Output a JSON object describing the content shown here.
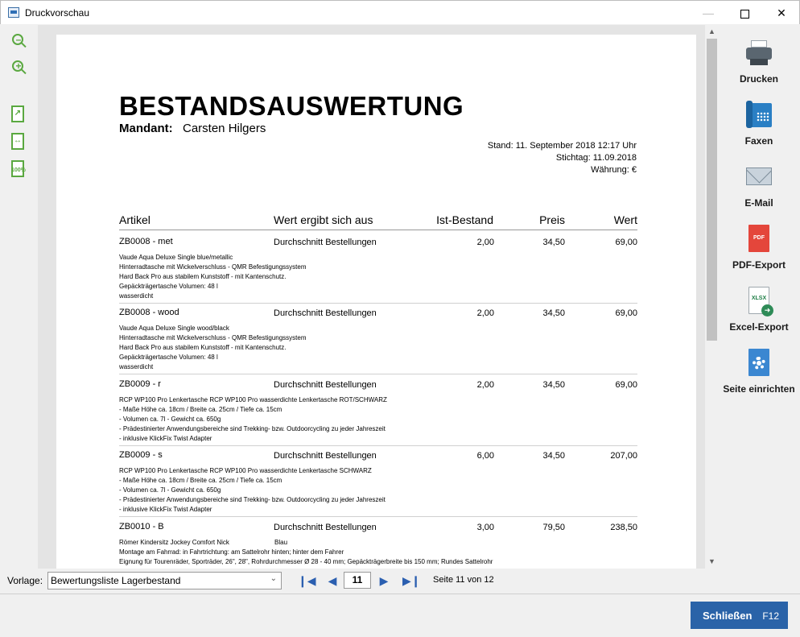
{
  "window": {
    "title": "Druckvorschau"
  },
  "toolbar_left": [
    {
      "name": "zoom-out",
      "icon": "zoom-out-icon"
    },
    {
      "name": "zoom-in",
      "icon": "zoom-in-icon"
    },
    {
      "name": "fit-page",
      "icon": "fit-page-icon"
    },
    {
      "name": "fit-width",
      "icon": "fit-width-icon"
    },
    {
      "name": "zoom-100",
      "icon": "zoom-100-icon",
      "text": "100%"
    }
  ],
  "report": {
    "title": "BESTANDSAUSWERTUNG",
    "mandant_label": "Mandant:",
    "mandant_value": "Carsten Hilgers",
    "stand": "Stand:  11. September 2018 12:17 Uhr",
    "stichtag": "Stichtag: 11.09.2018",
    "waehrung": "Währung: €",
    "columns": {
      "artikel": "Artikel",
      "wert_aus": "Wert ergibt sich aus",
      "ist_bestand": "Ist-Bestand",
      "preis": "Preis",
      "wert": "Wert"
    },
    "items": [
      {
        "artikel": "ZB0008 - met",
        "quelle": "Durchschnitt Bestellungen",
        "bestand": "2,00",
        "preis": "34,50",
        "wert": "69,00",
        "desc": [
          "Vaude Aqua Deluxe Single blue/metallic",
          "Hinterradtasche mit Wickelverschluss - QMR Befestigungssystem",
          "Hard Back Pro aus stabilem Kunststoff - mit Kantenschutz.",
          "Gepäckträgertasche Volumen: 48 l",
          "wasserdicht"
        ]
      },
      {
        "artikel": "ZB0008 - wood",
        "quelle": "Durchschnitt Bestellungen",
        "bestand": "2,00",
        "preis": "34,50",
        "wert": "69,00",
        "desc": [
          "Vaude Aqua Deluxe Single wood/black",
          "Hinterradtasche mit Wickelverschluss - QMR Befestigungssystem",
          "Hard Back Pro aus stabilem Kunststoff - mit Kantenschutz.",
          "Gepäckträgertasche Volumen: 48 l",
          "wasserdicht"
        ]
      },
      {
        "artikel": "ZB0009 - r",
        "quelle": "Durchschnitt Bestellungen",
        "bestand": "2,00",
        "preis": "34,50",
        "wert": "69,00",
        "desc": [
          "RCP WP100 Pro Lenkertasche RCP WP100 Pro wasserdichte Lenkertasche ROT/SCHWARZ",
          "- Maße  Höhe ca. 18cm / Breite ca. 25cm / Tiefe ca. 15cm",
          "- Volumen ca. 7l - Gewicht ca. 650g",
          "- Prädestinierter Anwendungsbereiche sind Trekking- bzw. Outdoorcycling zu jeder Jahreszeit",
          "- inklusive KlickFix Twist Adapter"
        ]
      },
      {
        "artikel": "ZB0009 - s",
        "quelle": "Durchschnitt Bestellungen",
        "bestand": "6,00",
        "preis": "34,50",
        "wert": "207,00",
        "desc": [
          "RCP WP100 Pro Lenkertasche RCP WP100 Pro wasserdichte Lenkertasche SCHWARZ",
          "- Maße  Höhe ca. 18cm / Breite ca. 25cm / Tiefe ca. 15cm",
          "- Volumen ca. 7l - Gewicht ca. 650g",
          "- Prädestinierter Anwendungsbereiche sind Trekking- bzw. Outdoorcycling zu jeder Jahreszeit",
          "- inklusive KlickFix Twist Adapter"
        ]
      },
      {
        "artikel": "ZB0010 - B",
        "quelle": "Durchschnitt Bestellungen",
        "bestand": "3,00",
        "preis": "79,50",
        "wert": "238,50",
        "desc": [
          "Römer Kindersitz Jockey Comfort Nick",
          "Montage am Fahrrad:  in Fahrtrichtung: am Sattelrohr hinten;  hinter dem Fahrer",
          "Eignung für  Touren­räder, Sporträder,  26\", 28\",  Rohrdurchmesser Ø 28 - 40 mm; Gepäckträgerbreite bis 150 mm; Rundes Sattelrohr"
        ],
        "desc_extra": "Blau"
      }
    ]
  },
  "toolbar_right": [
    {
      "label": "Drucken",
      "icon": "printer-icon"
    },
    {
      "label": "Faxen",
      "icon": "fax-icon"
    },
    {
      "label": "E-Mail",
      "icon": "mail-icon"
    },
    {
      "label": "PDF-Export",
      "icon": "pdf-icon",
      "badge": "PDF"
    },
    {
      "label": "Excel-Export",
      "icon": "excel-icon",
      "badge": "XLSX"
    },
    {
      "label": "Seite einrichten",
      "icon": "page-setup-icon"
    }
  ],
  "bottom": {
    "vorlage_label": "Vorlage:",
    "vorlage_value": "Bewertungsliste Lagerbestand",
    "current_page": "11",
    "page_info": "Seite 11 von 12"
  },
  "footer": {
    "close_label": "Schließen",
    "close_key": "F12"
  },
  "colors": {
    "accent": "#2a63a8",
    "icon_green": "#5aa840",
    "nav_blue": "#2b5fb0"
  }
}
